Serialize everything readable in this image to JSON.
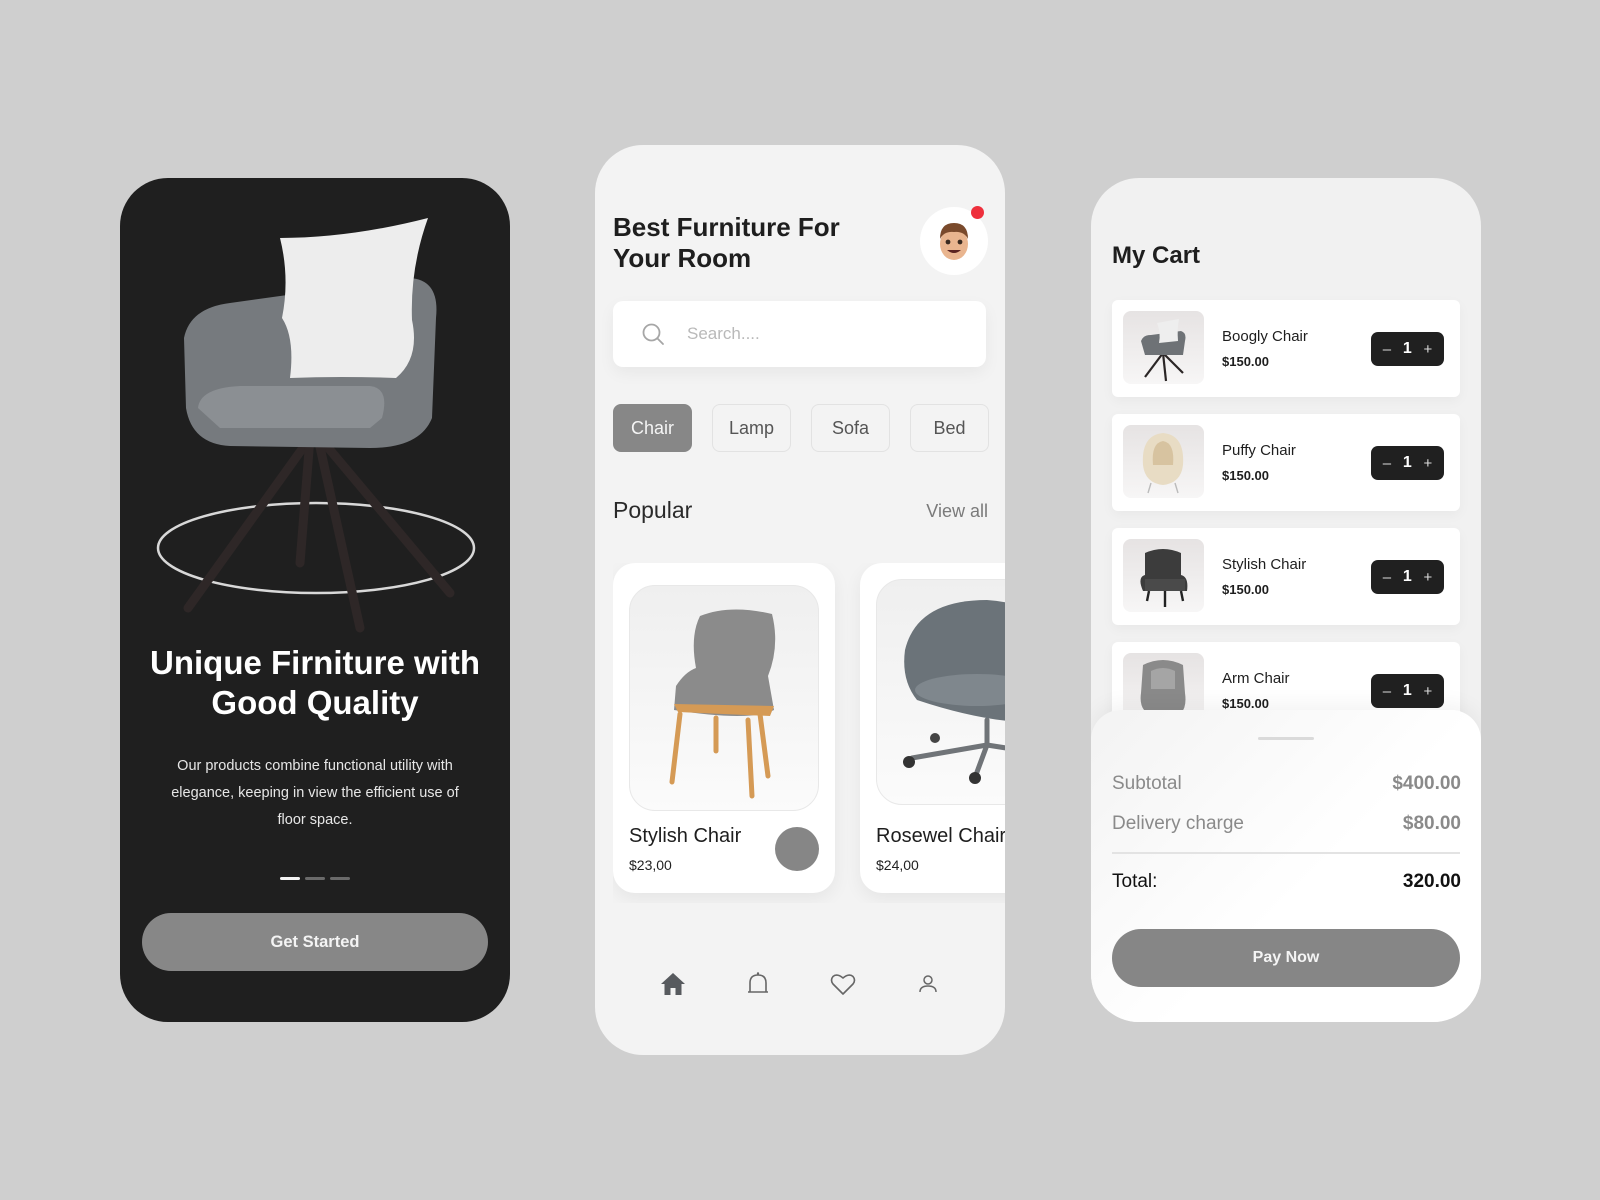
{
  "onboarding": {
    "title_line1": "Unique Firniture with",
    "title_line2": "Good Quality",
    "description": "Our products combine functional utility with elegance, keeping in view the efficient use of floor space.",
    "pager": {
      "total": 3,
      "active_index": 0
    },
    "cta_label": "Get Started"
  },
  "home": {
    "title_line1": "Best Furniture For",
    "title_line2": "Your Room",
    "avatar_icon": "memoji-avatar",
    "has_notification": true,
    "search": {
      "placeholder": "Search....",
      "value": ""
    },
    "categories": [
      {
        "label": "Chair",
        "active": true
      },
      {
        "label": "Lamp",
        "active": false
      },
      {
        "label": "Sofa",
        "active": false
      },
      {
        "label": "Bed",
        "active": false
      }
    ],
    "section_title": "Popular",
    "view_all_label": "View all",
    "products": [
      {
        "name": "Stylish Chair",
        "price": "$23,00"
      },
      {
        "name": "Rosewel Chair",
        "price": "$24,00"
      }
    ],
    "nav": [
      {
        "icon": "home-icon",
        "active": true
      },
      {
        "icon": "bell-icon",
        "active": false
      },
      {
        "icon": "heart-icon",
        "active": false
      },
      {
        "icon": "user-icon",
        "active": false
      }
    ]
  },
  "cart": {
    "title": "My Cart",
    "items": [
      {
        "name": "Boogly Chair",
        "price": "$150.00",
        "qty": "1"
      },
      {
        "name": "Puffy Chair",
        "price": "$150.00",
        "qty": "1"
      },
      {
        "name": "Stylish Chair",
        "price": "$150.00",
        "qty": "1"
      },
      {
        "name": "Arm Chair",
        "price": "$150.00",
        "qty": "1"
      }
    ],
    "stepper": {
      "minus": "–",
      "plus": "+"
    },
    "subtotal_label": "Subtotal",
    "subtotal_value": "$400.00",
    "delivery_label": "Delivery charge",
    "delivery_value": "$80.00",
    "total_label": "Total:",
    "total_value": "320.00",
    "pay_label": "Pay Now"
  },
  "colors": {
    "dark": "#1f1f1f",
    "accent_gray": "#878787",
    "notification": "#ee2f3c",
    "background": "#cfcfcf"
  }
}
